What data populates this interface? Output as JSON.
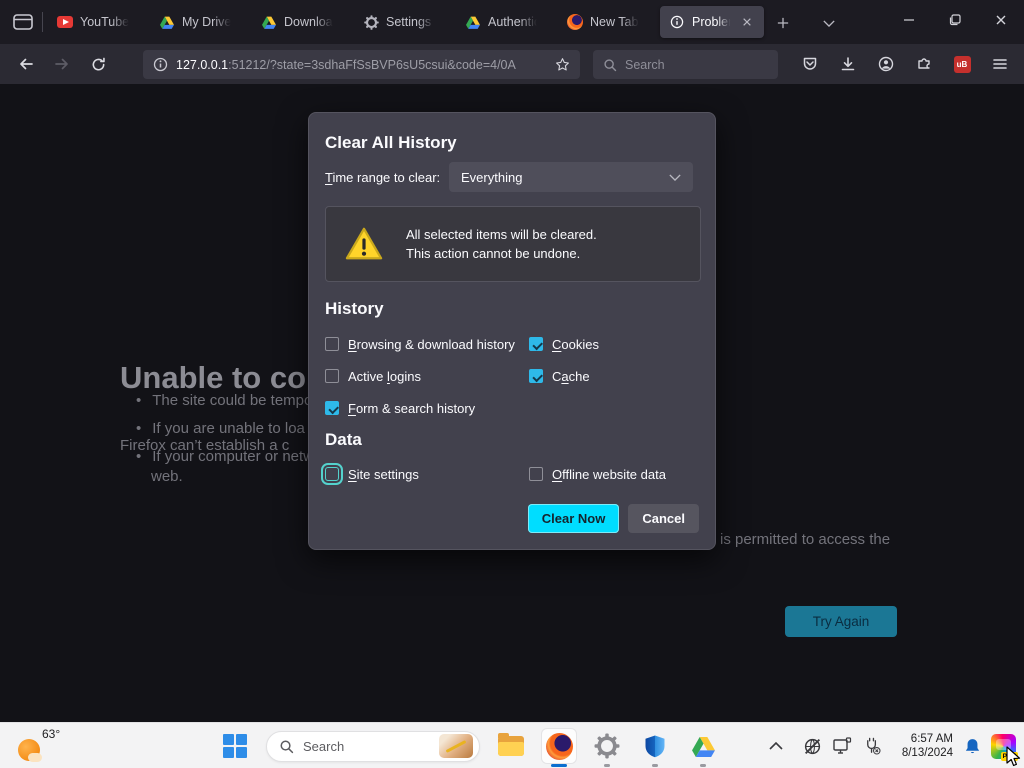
{
  "colors": {
    "accent_cyan": "#00ddff",
    "checkbox_checked": "#2eb9e9",
    "focus_ring": "#54d2cd",
    "warning_yellow": "#ffd42a",
    "ublock_red": "#c5302d",
    "taskbar_bg": "#f3f3f4",
    "chrome_bg": "#1c1b22",
    "dialog_bg": "#42414d"
  },
  "browser": {
    "tabs": [
      {
        "label": "YouTube",
        "icon": "youtube"
      },
      {
        "label": "My Drive -",
        "icon": "google-drive"
      },
      {
        "label": "Download",
        "icon": "google-drive"
      },
      {
        "label": "Settings",
        "icon": "gear"
      },
      {
        "label": "Authentica",
        "icon": "google-drive"
      },
      {
        "label": "New Tab",
        "icon": "firefox"
      },
      {
        "label": "Problem",
        "icon": "info",
        "active": true
      }
    ],
    "urlbar": {
      "host": "127.0.0.1",
      "rest": ":51212/?state=3sdhaFfSsBVP6sU5csui&code=4/0A"
    },
    "search_placeholder": "Search",
    "ublock_label": "uB"
  },
  "page": {
    "heading": "Unable to co",
    "subheading": "Firefox can’t establish a c",
    "bullets": [
      "The site could be tempo",
      "If you are unable to loa",
      "If your computer or netw"
    ],
    "bullet3_wrap": "web.",
    "right_fragment": "is permitted to access the",
    "try_again_label": "Try Again"
  },
  "dialog": {
    "title": "Clear All History",
    "time_range": {
      "label_pre": "",
      "label_key": "T",
      "label_post": "ime range to clear:",
      "value": "Everything"
    },
    "warning": {
      "line1": "All selected items will be cleared.",
      "line2": "This action cannot be undone."
    },
    "history_heading": "History",
    "history_items": [
      {
        "pre": "",
        "key": "B",
        "post": "rowsing & download history",
        "checked": false
      },
      {
        "pre": "",
        "key": "C",
        "post": "ookies",
        "checked": true
      },
      {
        "pre": "Active ",
        "key": "l",
        "post": "ogins",
        "checked": false
      },
      {
        "pre": "C",
        "key": "a",
        "post": "che",
        "checked": true
      },
      {
        "pre": "",
        "key": "F",
        "post": "orm & search history",
        "checked": true
      }
    ],
    "data_heading": "Data",
    "data_items": [
      {
        "pre": "",
        "key": "S",
        "post": "ite settings",
        "checked": false,
        "focused": true
      },
      {
        "pre": "",
        "key": "O",
        "post": "ffline website data",
        "checked": false
      }
    ],
    "clear_button": "Clear Now",
    "cancel_button": "Cancel"
  },
  "taskbar": {
    "weather_temp": "63°",
    "search_placeholder": "Search",
    "time": "6:57 AM",
    "date": "8/13/2024",
    "insider_label": "PRE"
  }
}
